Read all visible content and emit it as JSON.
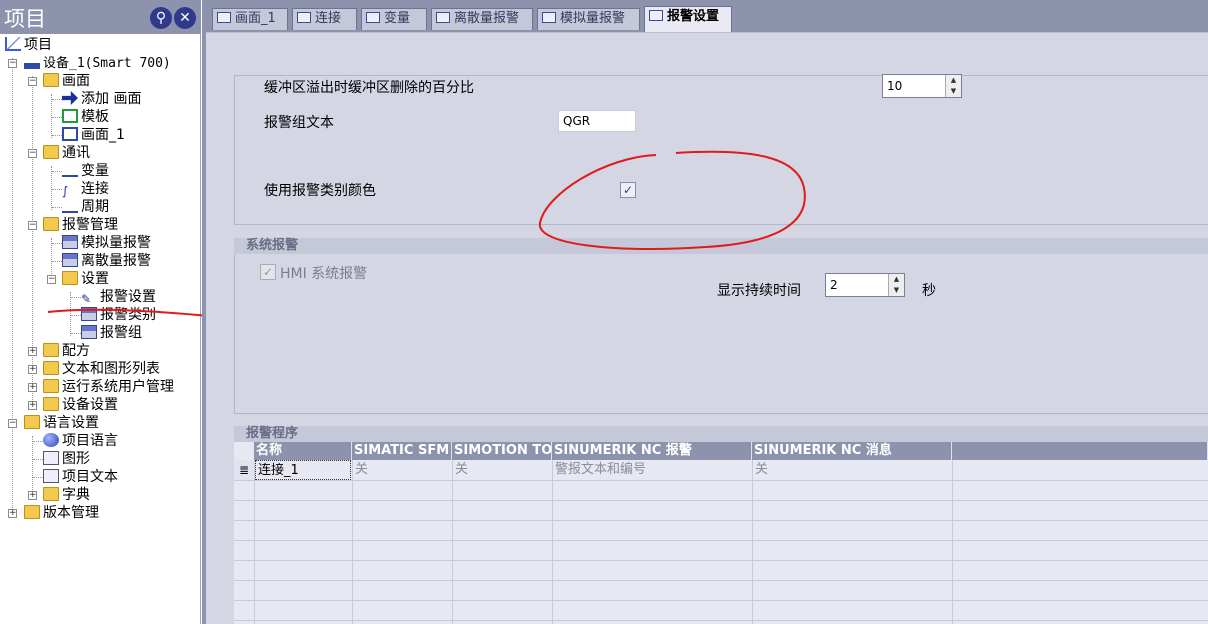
{
  "project_pane": {
    "title": "项目",
    "pin_icon": "pin-icon",
    "close_icon": "close-icon",
    "tree": {
      "project": "项目",
      "device": "设备_1(Smart 700)",
      "screens": "画面",
      "add_screen": "添加 画面",
      "template": "模板",
      "screen_1": "画面_1",
      "communication": "通讯",
      "variables": "变量",
      "connections": "连接",
      "cycles": "周期",
      "alarm_management": "报警管理",
      "analog_alarms": "模拟量报警",
      "discrete_alarms": "离散量报警",
      "settings": "设置",
      "alarm_settings": "报警设置",
      "alarm_classes": "报警类别",
      "alarm_groups": "报警组",
      "recipes": "配方",
      "text_graphic_lists": "文本和图形列表",
      "runtime_user_admin": "运行系统用户管理",
      "device_settings": "设备设置",
      "language_settings": "语言设置",
      "project_languages": "项目语言",
      "graphics": "图形",
      "project_texts": "项目文本",
      "dictionaries": "字典",
      "version_management": "版本管理"
    }
  },
  "tabs": [
    {
      "label": "画面_1"
    },
    {
      "label": "连接"
    },
    {
      "label": "变量"
    },
    {
      "label": "离散量报警"
    },
    {
      "label": "模拟量报警"
    },
    {
      "label": "报警设置"
    }
  ],
  "general": {
    "buffer_overflow_label": "缓冲区溢出时缓冲区删除的百分比",
    "buffer_overflow_value": "10",
    "alarm_group_text_label": "报警组文本",
    "alarm_group_text_value": "QGR",
    "use_class_colors_label": "使用报警类别颜色",
    "use_class_colors_checked": "✓"
  },
  "system_alarms": {
    "title": "系统报警",
    "hmi_system_alarms_label": "HMI 系统报警",
    "hmi_checked": "✓",
    "display_duration_label": "显示持续时间",
    "display_duration_value": "2",
    "unit": "秒"
  },
  "alarm_procedures": {
    "title": "报警程序",
    "columns": [
      "名称",
      "SIMATIC SFM",
      "SIMOTION TO",
      "SINUMERIK NC 报警",
      "SINUMERIK NC 消息"
    ],
    "rows": [
      [
        "连接_1",
        "关",
        "关",
        "警报文本和编号",
        "关"
      ]
    ],
    "row_marker": "≣"
  },
  "annotation_colors": {
    "red_pen": "#e11a1a"
  }
}
